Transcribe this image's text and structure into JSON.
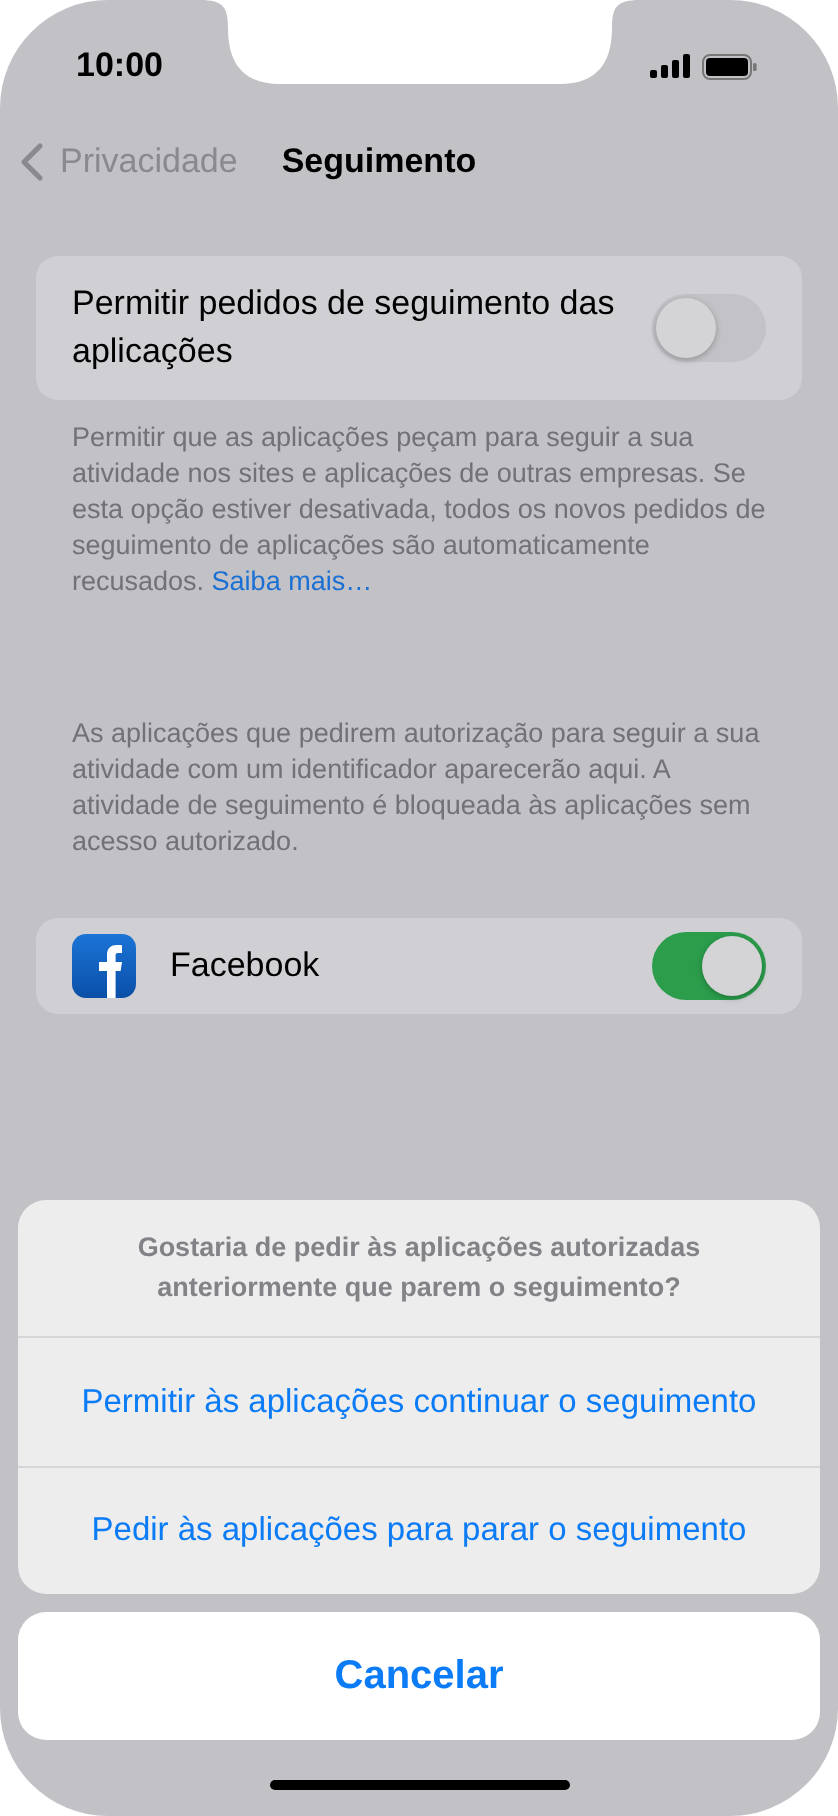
{
  "status_bar": {
    "time": "10:00"
  },
  "nav": {
    "back_label": "Privacidade",
    "title": "Seguimento"
  },
  "tracking_toggle": {
    "label": "Permitir pedidos de seguimento das aplicações",
    "on": false
  },
  "tracking_footer": {
    "text": "Permitir que as aplicações peçam para seguir a sua atividade nos sites e aplicações de outras empresas. Se esta opção estiver desativada, todos os novos pedidos de seguimento de aplicações são automaticamente recusados.",
    "link": "Saiba mais…"
  },
  "apps_description": "As aplicações que pedirem autorização para seguir a sua atividade com um identificador aparecerão aqui. A atividade de seguimento é bloqueada às aplicações sem acesso autorizado.",
  "apps": [
    {
      "name": "Facebook",
      "on": true
    }
  ],
  "action_sheet": {
    "message": "Gostaria de pedir às aplicações autorizadas anteriormente que parem o seguimento?",
    "actions": [
      "Permitir às aplicações continuar o seguimento",
      "Pedir às aplicações para parar o seguimento"
    ],
    "cancel": "Cancelar"
  }
}
